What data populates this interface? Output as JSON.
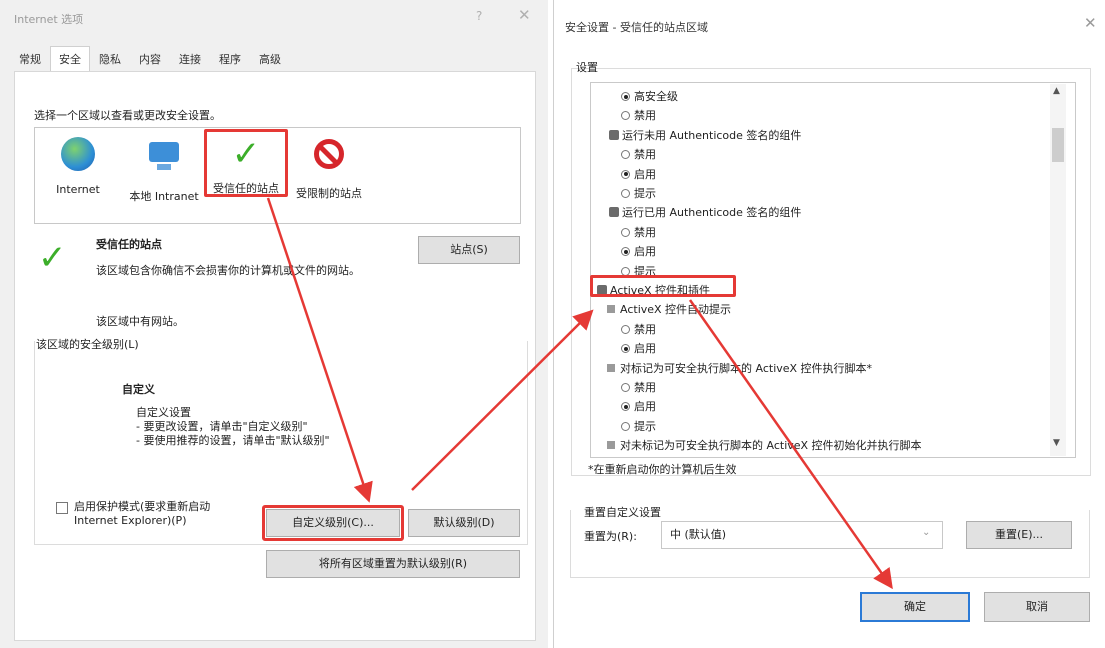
{
  "left": {
    "title": "Internet 选项",
    "help": "?",
    "close": "✕",
    "tabs": [
      "常规",
      "安全",
      "隐私",
      "内容",
      "连接",
      "程序",
      "高级"
    ],
    "zone_prompt": "选择一个区域以查看或更改安全设置。",
    "zones": [
      "Internet",
      "本地 Intranet",
      "受信任的站点",
      "受限制的站点"
    ],
    "site_title": "受信任的站点",
    "site_desc": "该区域包含你确信不会损害你的计算机或文件的网站。",
    "site_nosites": "该区域中有网站。",
    "sites_button": "站点(S)",
    "security_level_label": "该区域的安全级别(L)",
    "custom_title": "自定义",
    "custom_lines": [
      "自定义设置",
      "- 要更改设置，请单击\"自定义级别\"",
      "- 要使用推荐的设置，请单击\"默认级别\""
    ],
    "protected_mode_line1": "启用保护模式(要求重新启动",
    "protected_mode_line2": "Internet Explorer)(P)",
    "custom_level_button": "自定义级别(C)...",
    "default_level_button": "默认级别(D)",
    "reset_all_button": "将所有区域重置为默认级别(R)"
  },
  "right": {
    "title": "安全设置 - 受信任的站点区域",
    "close": "✕",
    "settings_label": "设置",
    "rows": [
      {
        "kind": "radio",
        "on": true,
        "text": "高安全级"
      },
      {
        "kind": "radio",
        "on": false,
        "text": "禁用"
      },
      {
        "kind": "group",
        "text": "运行未用 Authenticode 签名的组件"
      },
      {
        "kind": "radio",
        "on": false,
        "text": "禁用"
      },
      {
        "kind": "radio",
        "on": true,
        "text": "启用"
      },
      {
        "kind": "radio",
        "on": false,
        "text": "提示"
      },
      {
        "kind": "group",
        "text": "运行已用 Authenticode 签名的组件"
      },
      {
        "kind": "radio",
        "on": false,
        "text": "禁用"
      },
      {
        "kind": "radio",
        "on": true,
        "text": "启用"
      },
      {
        "kind": "radio",
        "on": false,
        "text": "提示"
      },
      {
        "kind": "top",
        "text": "ActiveX 控件和插件"
      },
      {
        "kind": "sub",
        "text": "ActiveX 控件自动提示"
      },
      {
        "kind": "radio",
        "on": false,
        "text": "禁用"
      },
      {
        "kind": "radio",
        "on": true,
        "text": "启用"
      },
      {
        "kind": "sub",
        "text": "对标记为可安全执行脚本的 ActiveX 控件执行脚本*"
      },
      {
        "kind": "radio",
        "on": false,
        "text": "禁用"
      },
      {
        "kind": "radio",
        "on": true,
        "text": "启用"
      },
      {
        "kind": "radio",
        "on": false,
        "text": "提示"
      },
      {
        "kind": "sub",
        "text": "对未标记为可安全执行脚本的 ActiveX 控件初始化并执行脚本"
      }
    ],
    "restart_note": "*在重新启动你的计算机后生效",
    "reset_group_label": "重置自定义设置",
    "reset_to_label": "重置为(R):",
    "reset_value": "中 (默认值)",
    "reset_button": "重置(E)...",
    "ok_button": "确定",
    "cancel_button": "取消"
  },
  "colors": {
    "highlight": "#e53935",
    "check": "#3cae2a",
    "ok_border": "#2b7ad6"
  }
}
